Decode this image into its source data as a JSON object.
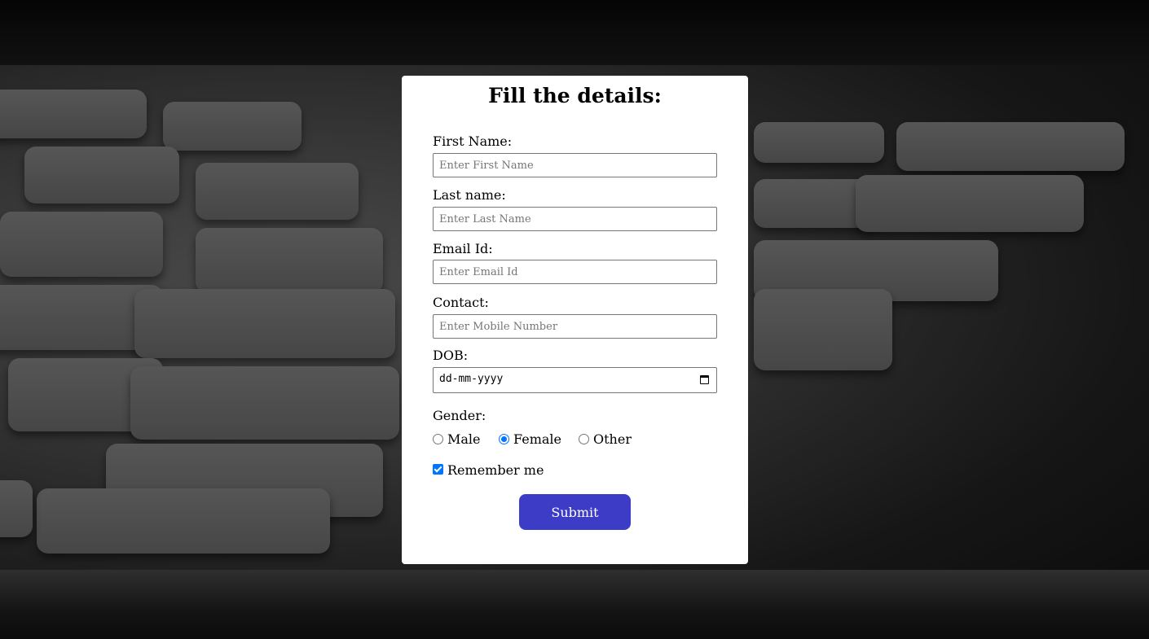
{
  "form": {
    "title": "Fill the details:",
    "first_name": {
      "label": "First Name:",
      "placeholder": "Enter First Name",
      "value": ""
    },
    "last_name": {
      "label": "Last name:",
      "placeholder": "Enter Last Name",
      "value": ""
    },
    "email": {
      "label": "Email Id:",
      "placeholder": "Enter Email Id",
      "value": ""
    },
    "contact": {
      "label": "Contact:",
      "placeholder": "Enter Mobile Number",
      "value": ""
    },
    "dob": {
      "label": "DOB:",
      "display": "dd-mm-yyyy"
    },
    "gender": {
      "label": "Gender:",
      "options": [
        {
          "label": "Male",
          "checked": false
        },
        {
          "label": "Female",
          "checked": true
        },
        {
          "label": "Other",
          "checked": false
        }
      ],
      "selected": "Female"
    },
    "remember": {
      "label": "Remember me",
      "checked": true
    },
    "submit_label": "Submit"
  },
  "colors": {
    "accent": "#0075ff",
    "button": "#3c3cc6",
    "card": "#ffffff"
  }
}
